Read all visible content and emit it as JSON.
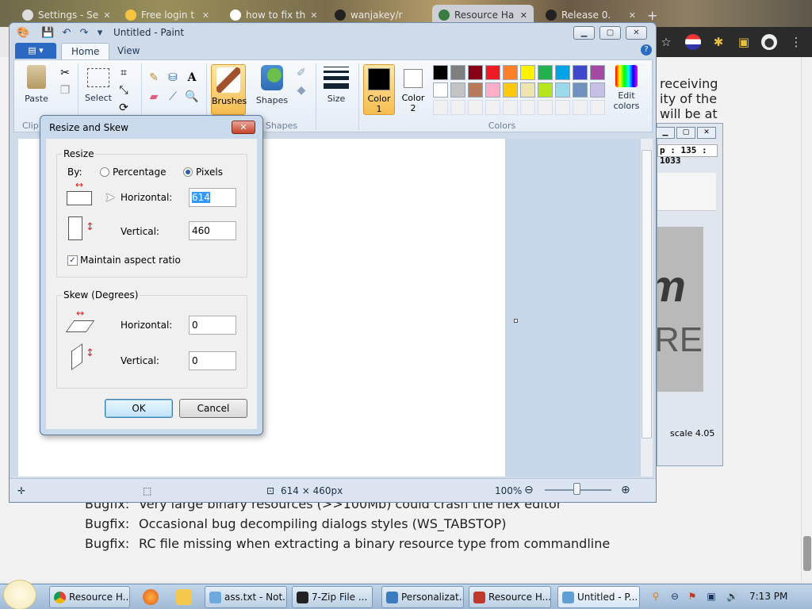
{
  "browser": {
    "tabs": [
      {
        "label": "Settings - Se"
      },
      {
        "label": "Free login t"
      },
      {
        "label": "how to fix th"
      },
      {
        "label": "wanjakey/r"
      },
      {
        "label": "Resource Ha"
      },
      {
        "label": "Release 0."
      }
    ],
    "page_right_text": [
      "receiving",
      "ity of the",
      "will be at"
    ],
    "bug_lines": [
      {
        "kind": "Bugfix:",
        "text": "Very large binary resources (>>100Mb) could crash the hex editor"
      },
      {
        "kind": "Bugfix:",
        "text": "Occasional bug decompiling dialogs styles (WS_TABSTOP)"
      },
      {
        "kind": "Bugfix:",
        "text": "RC file missing when extracting a binary resource type from commandline"
      }
    ]
  },
  "resource_hacker": {
    "coord": "p : 135 : 1033",
    "scale": "scale 4.05",
    "image_text_big": "m",
    "image_text_small": "RE"
  },
  "paint": {
    "title": "Untitled - Paint",
    "tabs": {
      "home": "Home",
      "view": "View"
    },
    "help": "?",
    "groups": {
      "clipboard": "Clip",
      "shapes": "Shapes",
      "colors": "Colors"
    },
    "buttons": {
      "paste": "Paste",
      "select": "Select",
      "brushes": "Brushes",
      "shapes": "Shapes",
      "size": "Size",
      "color1": "Color 1",
      "color2": "Color 2",
      "edit_colors": "Edit colors"
    },
    "palette": [
      "#000000",
      "#7f7f7f",
      "#880015",
      "#ed1c24",
      "#ff7f27",
      "#fff200",
      "#22b14c",
      "#00a2e8",
      "#3f48cc",
      "#a349a4",
      "#ffffff",
      "#c3c3c3",
      "#b97a57",
      "#ffaec9",
      "#ffc90e",
      "#efe4b0",
      "#b5e61d",
      "#99d9ea",
      "#7092be",
      "#c8bfe7"
    ],
    "status": {
      "size": "614 × 460px",
      "zoom": "100%"
    }
  },
  "dialog": {
    "title": "Resize and Skew",
    "resize_group": "Resize",
    "by_label": "By:",
    "percentage": "Percentage",
    "pixels": "Pixels",
    "horizontal_label": "Horizontal:",
    "vertical_label": "Vertical:",
    "resize_horizontal": "614",
    "resize_vertical": "460",
    "maintain_aspect": "Maintain aspect ratio",
    "skew_group": "Skew (Degrees)",
    "skew_horizontal": "0",
    "skew_vertical": "0",
    "ok": "OK",
    "cancel": "Cancel"
  },
  "taskbar": {
    "items": [
      {
        "label": "Resource H...",
        "color": "#e04a3a"
      },
      {
        "label": "ass.txt - Not...",
        "color": "#6fa8dc"
      },
      {
        "label": "7-Zip File ...",
        "color": "#222222"
      },
      {
        "label": "Personalizat...",
        "color": "#3b7bbf"
      },
      {
        "label": "Resource H...",
        "color": "#c0392b"
      },
      {
        "label": "Untitled - P...",
        "color": "#5f9fd5"
      }
    ],
    "clock": "7:13 PM"
  }
}
